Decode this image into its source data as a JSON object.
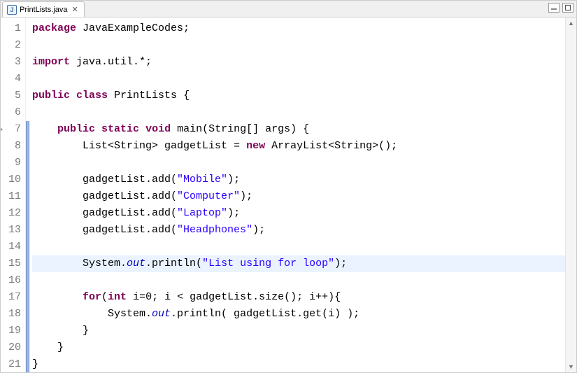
{
  "tab": {
    "icon_letter": "J",
    "title": "PrintLists.java"
  },
  "editor": {
    "highlighted_line": 15,
    "override_marker_line": 7,
    "marker_start": 7,
    "marker_end": 21,
    "lines": [
      {
        "n": 1,
        "tokens": [
          [
            "kw",
            "package"
          ],
          [
            "",
            " JavaExampleCodes;"
          ]
        ]
      },
      {
        "n": 2,
        "tokens": []
      },
      {
        "n": 3,
        "tokens": [
          [
            "kw",
            "import"
          ],
          [
            "",
            " java.util.*;"
          ]
        ]
      },
      {
        "n": 4,
        "tokens": []
      },
      {
        "n": 5,
        "tokens": [
          [
            "kw",
            "public"
          ],
          [
            "",
            " "
          ],
          [
            "kw",
            "class"
          ],
          [
            "",
            " PrintLists {"
          ]
        ]
      },
      {
        "n": 6,
        "tokens": []
      },
      {
        "n": 7,
        "tokens": [
          [
            "",
            "    "
          ],
          [
            "kw",
            "public"
          ],
          [
            "",
            " "
          ],
          [
            "kw",
            "static"
          ],
          [
            "",
            " "
          ],
          [
            "kw",
            "void"
          ],
          [
            "",
            " main(String[] args) {"
          ]
        ]
      },
      {
        "n": 8,
        "tokens": [
          [
            "",
            "        List<String> gadgetList = "
          ],
          [
            "kw",
            "new"
          ],
          [
            "",
            " ArrayList<String>();"
          ]
        ]
      },
      {
        "n": 9,
        "tokens": []
      },
      {
        "n": 10,
        "tokens": [
          [
            "",
            "        gadgetList.add("
          ],
          [
            "str",
            "\"Mobile\""
          ],
          [
            "",
            ");"
          ]
        ]
      },
      {
        "n": 11,
        "tokens": [
          [
            "",
            "        gadgetList.add("
          ],
          [
            "str",
            "\"Computer\""
          ],
          [
            "",
            ");"
          ]
        ]
      },
      {
        "n": 12,
        "tokens": [
          [
            "",
            "        gadgetList.add("
          ],
          [
            "str",
            "\"Laptop\""
          ],
          [
            "",
            ");"
          ]
        ]
      },
      {
        "n": 13,
        "tokens": [
          [
            "",
            "        gadgetList.add("
          ],
          [
            "str",
            "\"Headphones\""
          ],
          [
            "",
            ");"
          ]
        ]
      },
      {
        "n": 14,
        "tokens": []
      },
      {
        "n": 15,
        "tokens": [
          [
            "",
            "        System."
          ],
          [
            "fld",
            "out"
          ],
          [
            "",
            ".println("
          ],
          [
            "str",
            "\"List using for loop\""
          ],
          [
            "",
            ");"
          ]
        ]
      },
      {
        "n": 16,
        "tokens": []
      },
      {
        "n": 17,
        "tokens": [
          [
            "",
            "        "
          ],
          [
            "kw",
            "for"
          ],
          [
            "",
            "("
          ],
          [
            "kw",
            "int"
          ],
          [
            "",
            " i=0; i < gadgetList.size(); i++){"
          ]
        ]
      },
      {
        "n": 18,
        "tokens": [
          [
            "",
            "            System."
          ],
          [
            "fld",
            "out"
          ],
          [
            "",
            ".println( gadgetList.get(i) );"
          ]
        ]
      },
      {
        "n": 19,
        "tokens": [
          [
            "",
            "        }"
          ]
        ]
      },
      {
        "n": 20,
        "tokens": [
          [
            "",
            "    }"
          ]
        ]
      },
      {
        "n": 21,
        "tokens": [
          [
            "",
            "}"
          ]
        ]
      }
    ]
  }
}
